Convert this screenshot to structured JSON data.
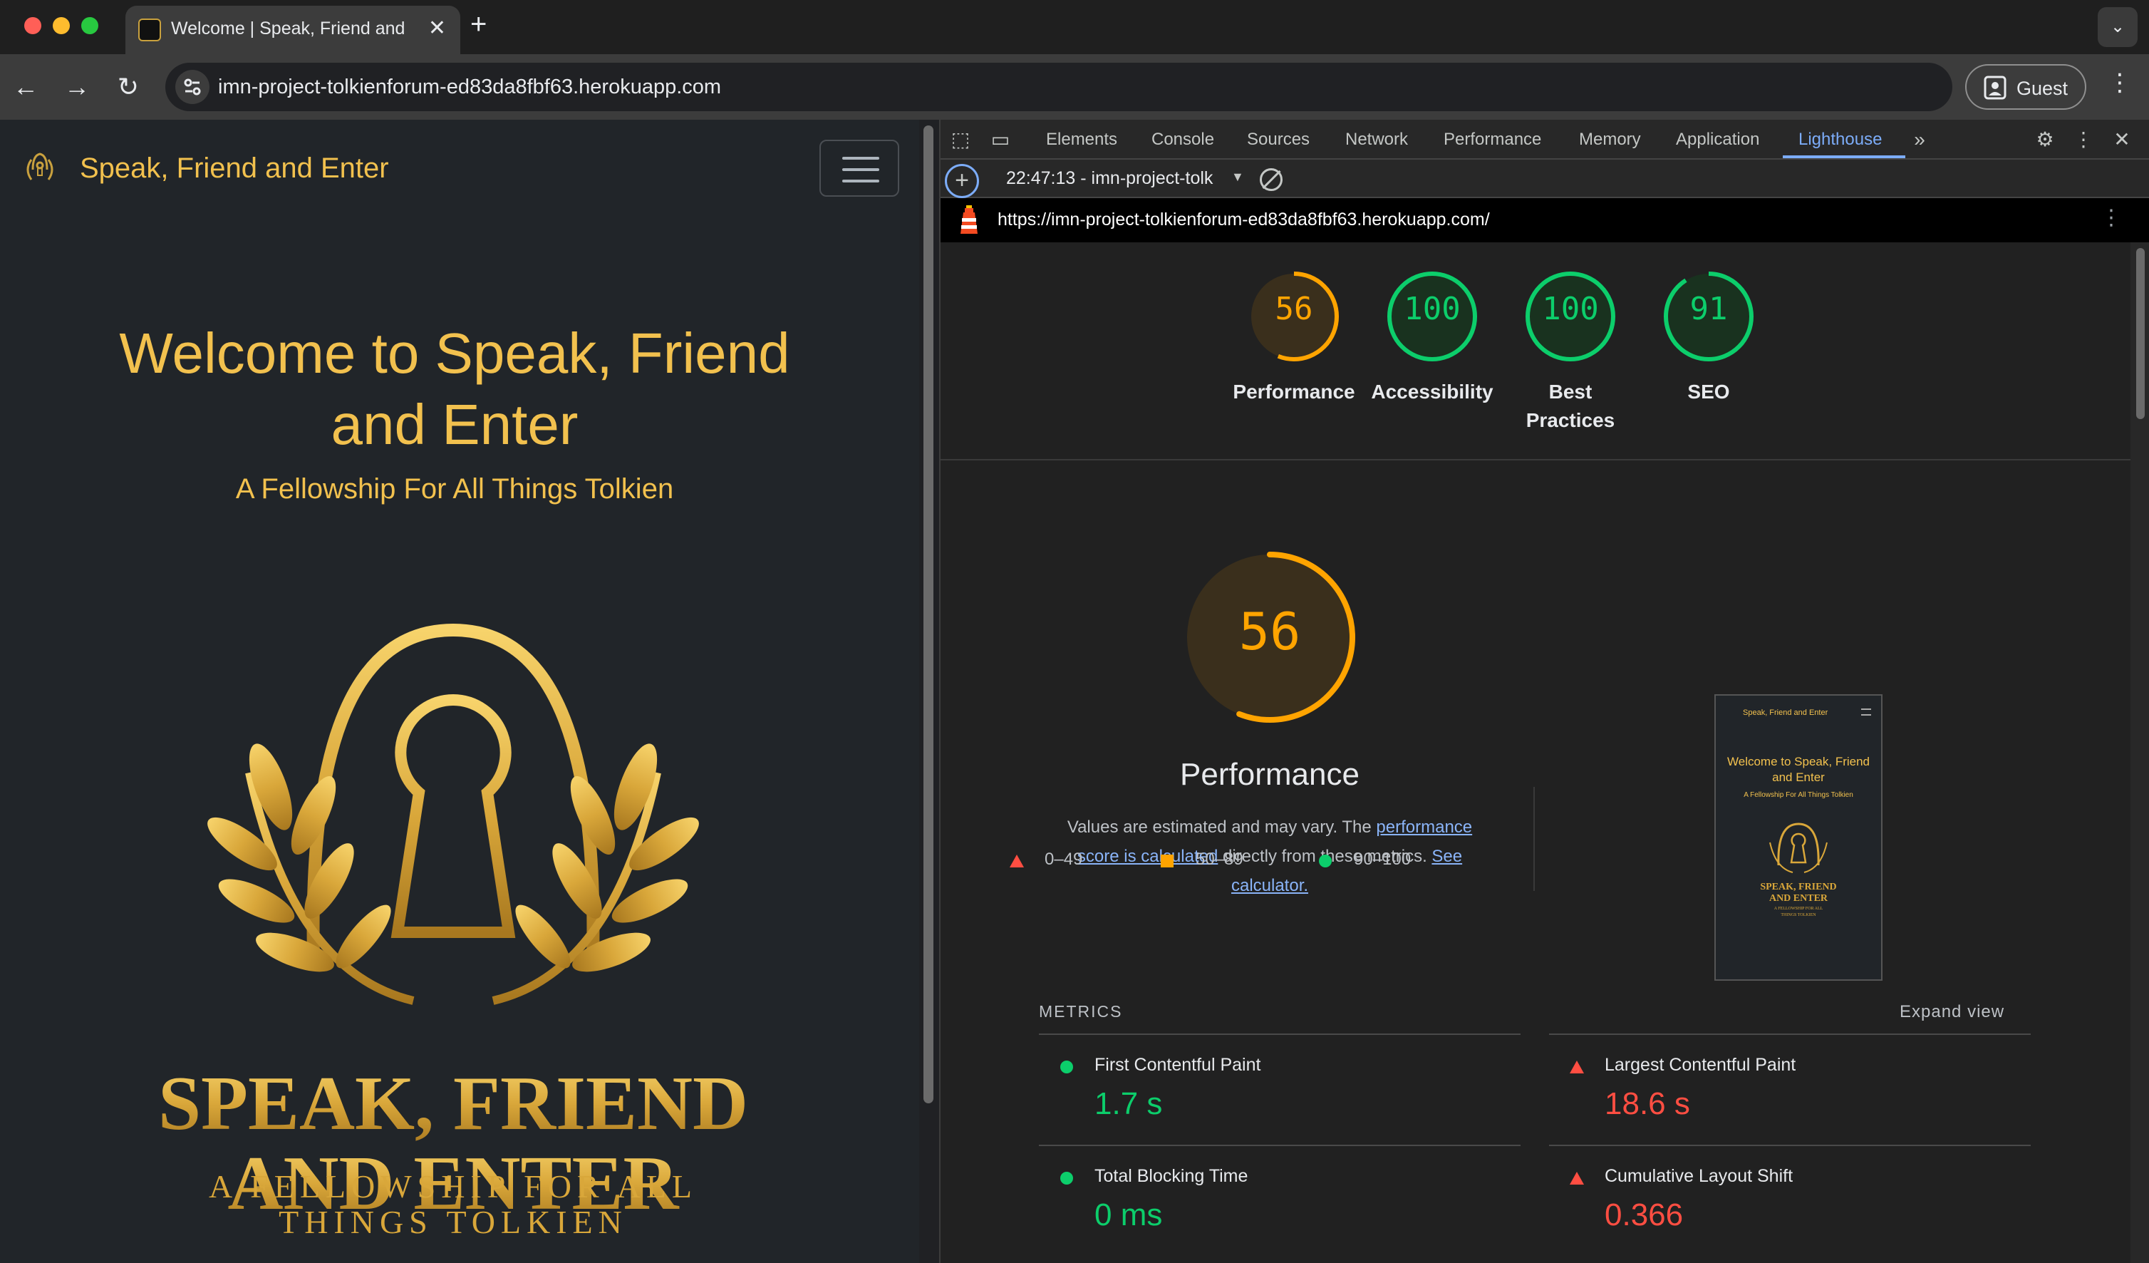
{
  "browser": {
    "tab_title": "Welcome | Speak, Friend and Enter",
    "url": "imn-project-tolkienforum-ed83da8fbf63.herokuapp.com",
    "profile_label": "Guest"
  },
  "site": {
    "brand": "Speak, Friend and Enter",
    "hero_line1": "Welcome to Speak, Friend",
    "hero_line2": "and Enter",
    "subtitle": "A Fellowship For All Things Tolkien",
    "logo_text_line1": "SPEAK, FRIEND",
    "logo_text_line2": "AND ENTER",
    "logo_tagline1": "A FELLOWSHIP FOR ALL",
    "logo_tagline2": "THINGS TOLKIEN"
  },
  "devtools": {
    "tabs": [
      "Elements",
      "Console",
      "Sources",
      "Network",
      "Performance",
      "Memory",
      "Application",
      "Lighthouse"
    ],
    "active_tab": "Lighthouse",
    "report_label": "22:47:13 - imn-project-tolk",
    "report_url": "https://imn-project-tolkienforum-ed83da8fbf63.herokuapp.com/"
  },
  "lighthouse": {
    "scores": [
      {
        "label_line1": "Performance",
        "label_line2": "",
        "score": 56,
        "color": "#ffa400"
      },
      {
        "label_line1": "Accessibility",
        "label_line2": "",
        "score": 100,
        "color": "#0cce6b"
      },
      {
        "label_line1": "Best",
        "label_line2": "Practices",
        "score": 100,
        "color": "#0cce6b"
      },
      {
        "label_line1": "SEO",
        "label_line2": "",
        "score": 91,
        "color": "#0cce6b"
      }
    ],
    "main_score": 56,
    "main_title": "Performance",
    "note_pre": "Values are estimated and may vary. The ",
    "note_link1": "performance score is calculated",
    "note_mid": " directly from these metrics. ",
    "note_link2": "See calculator.",
    "legend": [
      {
        "range": "0–49",
        "color": "#ff4e42"
      },
      {
        "range": "50–89",
        "color": "#ffa400"
      },
      {
        "range": "90–100",
        "color": "#0cce6b"
      }
    ],
    "metrics_heading": "METRICS",
    "expand_label": "Expand view",
    "metrics": [
      {
        "name": "First Contentful Paint",
        "value": "1.7 s",
        "status": "pass"
      },
      {
        "name": "Largest Contentful Paint",
        "value": "18.6 s",
        "status": "fail"
      },
      {
        "name": "Total Blocking Time",
        "value": "0 ms",
        "status": "pass"
      },
      {
        "name": "Cumulative Layout Shift",
        "value": "0.366",
        "status": "fail"
      }
    ],
    "thumb": {
      "brand": "Speak, Friend and Enter",
      "hero": "Welcome to Speak, Friend and Enter",
      "sub": "A Fellowship For All Things Tolkien",
      "logo_line1": "SPEAK, FRIEND",
      "logo_line2": "AND ENTER",
      "logo_line3": "A FELLOWSHIP FOR ALL",
      "logo_line4": "THINGS TOLKIEN"
    }
  }
}
